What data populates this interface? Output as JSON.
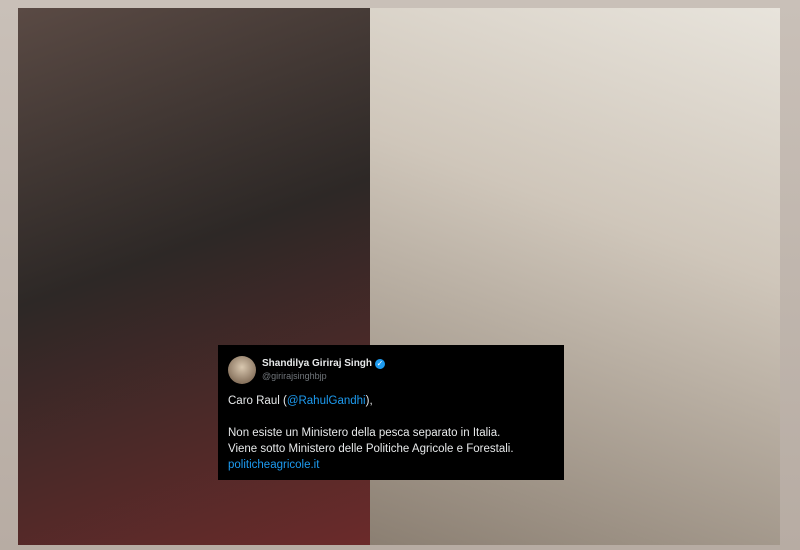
{
  "tweet": {
    "display_name": "Shandilya Giriraj Singh",
    "handle": "@girirajsinghbjp",
    "greeting_prefix": "Caro Raul (",
    "mention": "@RahulGandhi",
    "greeting_suffix": "),",
    "line1": "Non esiste un Ministero della pesca separato in Italia.",
    "line2": "Viene sotto Ministero delle Politiche Agricole e Forestali.",
    "link": "politicheagricole.it",
    "verified_icon": "verified-badge-icon"
  },
  "colors": {
    "tweet_background": "#000000",
    "tweet_text": "#e7e9ea",
    "accent_blue": "#1d9bf0",
    "handle_gray": "#71767b"
  }
}
